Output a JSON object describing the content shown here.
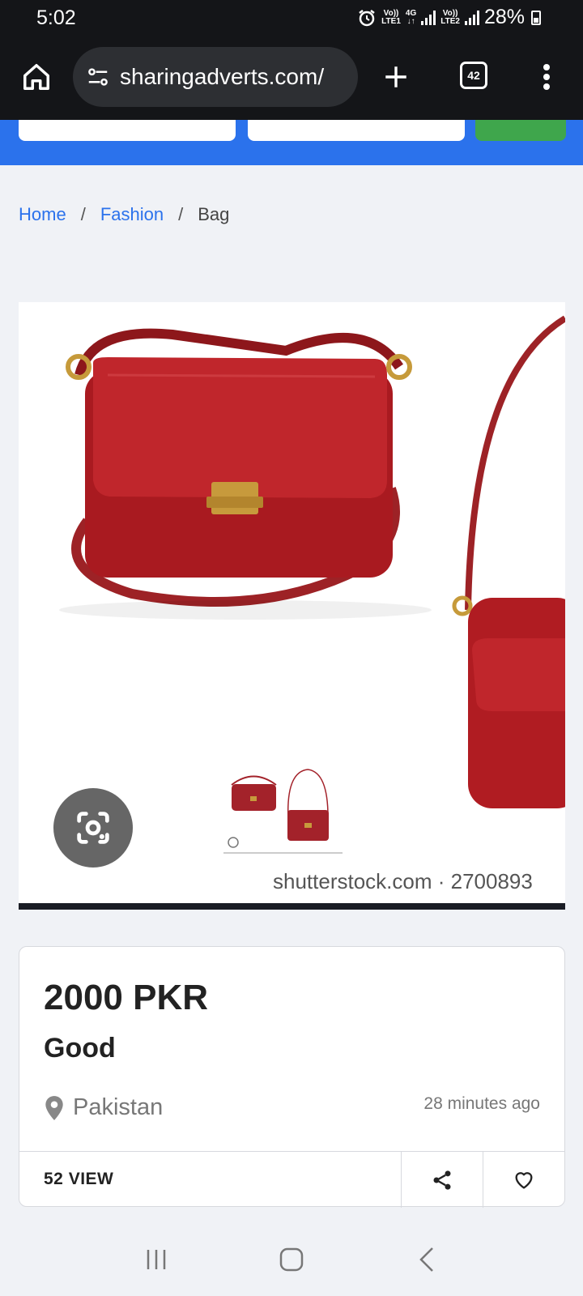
{
  "status_bar": {
    "time": "5:02",
    "sim1_label_top": "Vo))",
    "sim1_label_bottom": "LTE1",
    "network_type": "4G",
    "sim2_label_top": "Vo))",
    "sim2_label_bottom": "LTE2",
    "battery_percent": "28%"
  },
  "browser": {
    "url": "sharingadverts.com/",
    "tab_count": "42"
  },
  "breadcrumb": {
    "home": "Home",
    "separator": "/",
    "category": "Fashion",
    "current": "Bag"
  },
  "gallery": {
    "watermark": "shutterstock.com · 2700893"
  },
  "listing": {
    "price": "2000 PKR",
    "condition": "Good",
    "location": "Pakistan",
    "posted": "28 minutes ago",
    "views": "52 VIEW"
  },
  "colors": {
    "header_blue": "#2b72ec",
    "search_green": "#3fa64c",
    "bag_red": "#b01c22",
    "link_blue": "#2b72ec"
  },
  "icons": {
    "home": "home-icon",
    "site_settings": "tune-icon",
    "new_tab": "plus-icon",
    "menu": "more-vert-icon",
    "lens": "google-lens-icon",
    "location": "location-pin-icon",
    "share": "share-icon",
    "favorite": "heart-icon"
  }
}
